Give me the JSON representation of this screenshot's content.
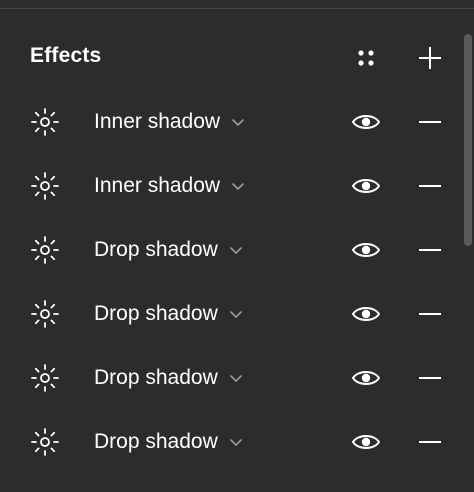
{
  "panel": {
    "title": "Effects",
    "icons": {
      "style_grid": "four-dots-style-icon",
      "add": "plus-icon"
    }
  },
  "effects": [
    {
      "type": "Inner shadow",
      "visible": true
    },
    {
      "type": "Inner shadow",
      "visible": true
    },
    {
      "type": "Drop shadow",
      "visible": true
    },
    {
      "type": "Drop shadow",
      "visible": true
    },
    {
      "type": "Drop shadow",
      "visible": true
    },
    {
      "type": "Drop shadow",
      "visible": true
    }
  ],
  "colors": {
    "background": "#2c2c2c",
    "text": "#ffffff",
    "muted_icon": "#9a9a9a",
    "scrollbar_thumb": "#5a5a5a"
  }
}
